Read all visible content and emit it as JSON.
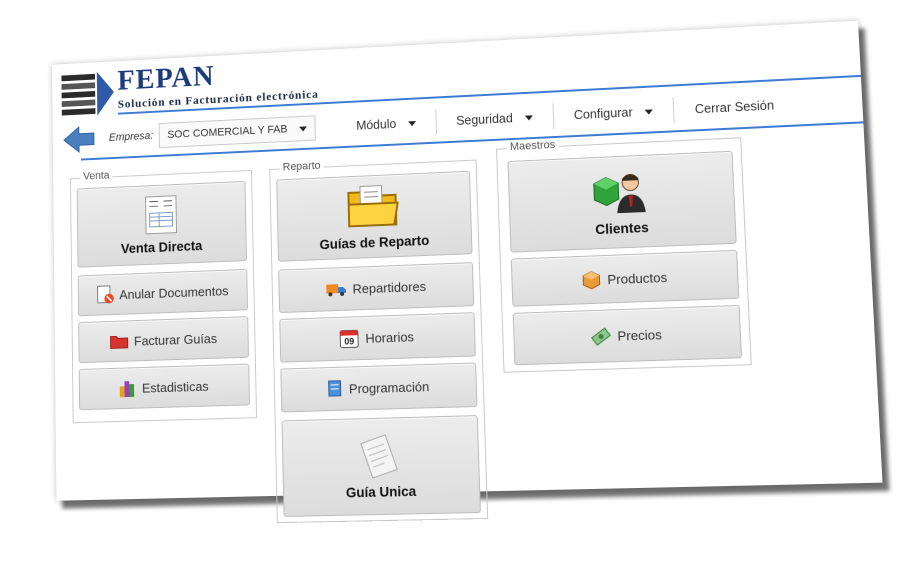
{
  "brand": {
    "title": "FEPAN",
    "subtitle": "Solución en Facturación electrónica"
  },
  "toolbar": {
    "empresa_label": "Empresa:",
    "empresa_value": "SOC COMERCIAL Y FAB",
    "menus": [
      "Módulo",
      "Seguridad",
      "Configurar"
    ],
    "logout": "Cerrar Sesión"
  },
  "venta": {
    "legend": "Venta",
    "main": "Venta Directa",
    "items": [
      "Anular Documentos",
      "Facturar Guías",
      "Estadisticas"
    ]
  },
  "reparto": {
    "legend": "Reparto",
    "main": "Guías de Reparto",
    "items": [
      "Repartidores",
      "Horarios",
      "Programación"
    ],
    "bottom": "Guía Unica"
  },
  "maestros": {
    "legend": "Maestros",
    "main": "Clientes",
    "items": [
      "Productos",
      "Precios"
    ]
  },
  "colors": {
    "brand": "#1d3b78",
    "accent_line": "#3b7bd4",
    "back_arrow": "#4a7fc0"
  }
}
